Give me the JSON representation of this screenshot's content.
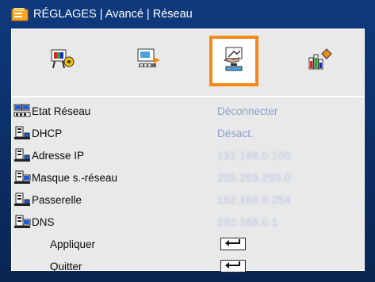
{
  "title": "RÉGLAGES | Avancé | Réseau",
  "tabs": [
    {
      "icon": "image-settings-icon",
      "selected": false
    },
    {
      "icon": "display-settings-icon",
      "selected": false
    },
    {
      "icon": "settings-hand-icon",
      "selected": true
    },
    {
      "icon": "options-info-icon",
      "selected": false
    }
  ],
  "rows": [
    {
      "label": "Etat Réseau",
      "value": "Déconnecter",
      "icon": "network-status-icon"
    },
    {
      "label": "DHCP",
      "value": "Désact.",
      "icon": "network-plug-icon"
    },
    {
      "label": "Adresse IP",
      "value": "192.168.0.100",
      "icon": "network-plug-icon"
    },
    {
      "label": "Masque s.-réseau",
      "value": "255.255.255.0",
      "icon": "network-card-icon"
    },
    {
      "label": "Passerelle",
      "value": "192.168.0.254",
      "icon": "network-plug-icon"
    },
    {
      "label": "DNS",
      "value": "192.168.0.1",
      "icon": "network-card-icon"
    },
    {
      "label": "Appliquer",
      "icon": "enter-key-icon"
    },
    {
      "label": "Quitter",
      "icon": "enter-key-icon"
    }
  ],
  "colors": {
    "accent": "#f28a1a",
    "value_text": "#8aa2cf",
    "background": "#0b2a5e"
  }
}
